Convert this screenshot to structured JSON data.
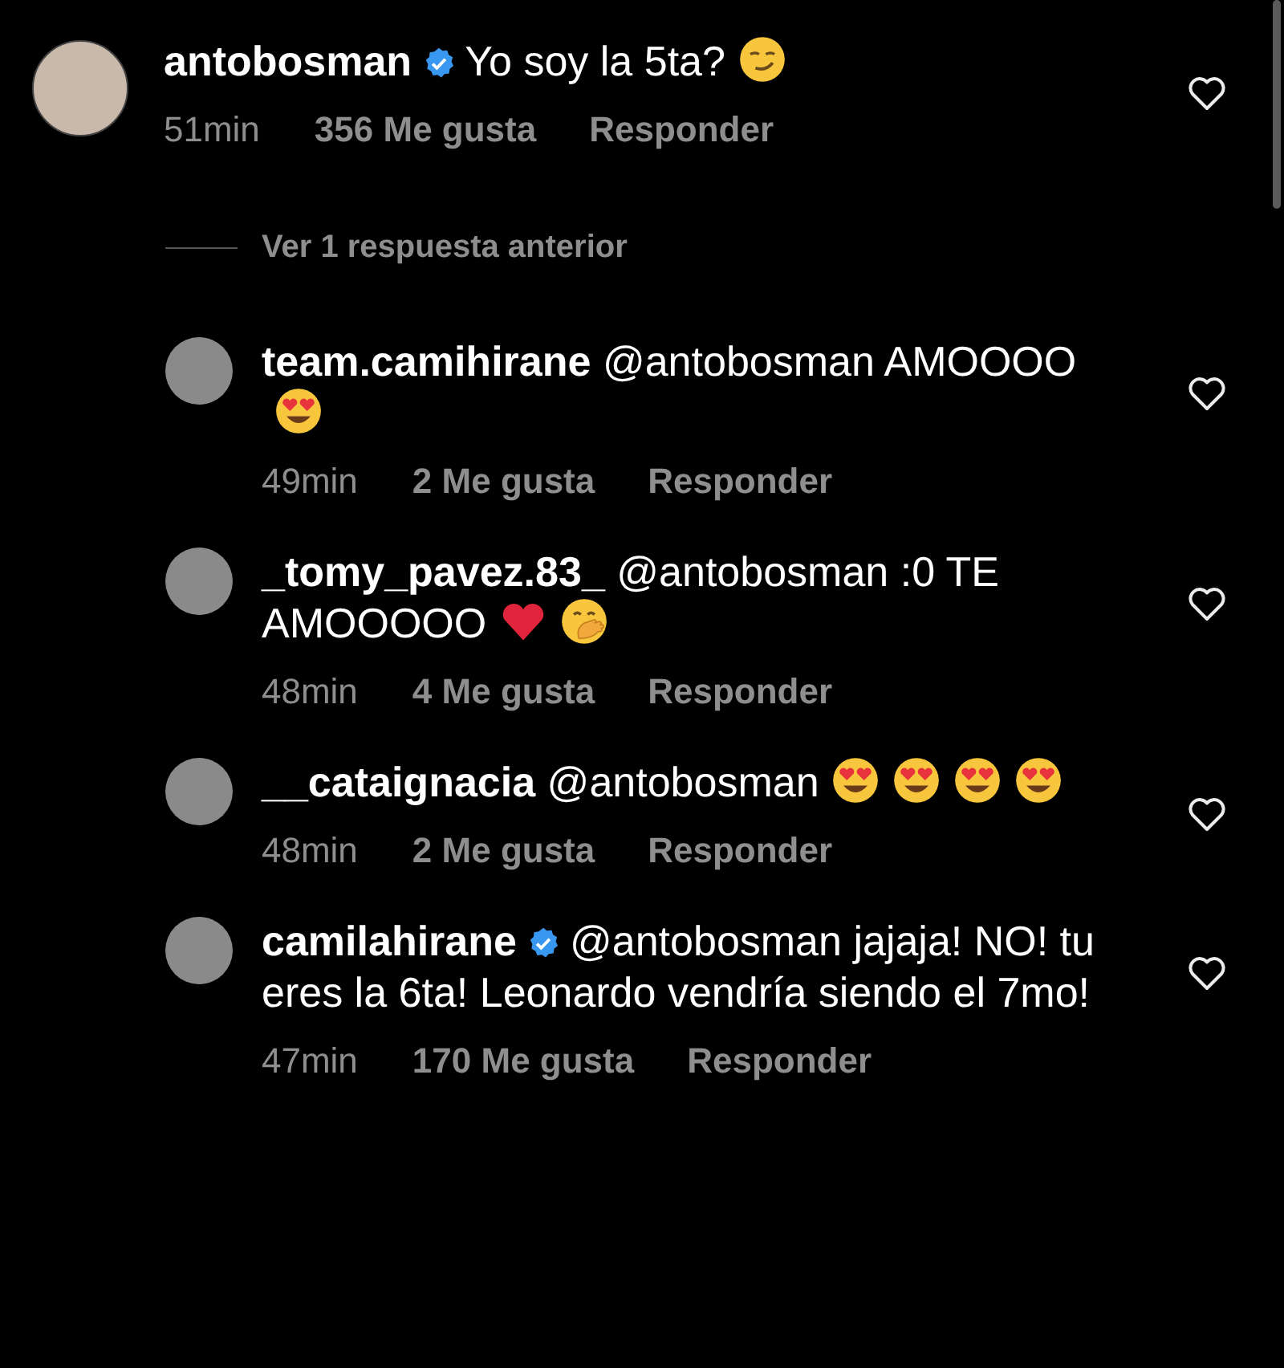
{
  "comment": {
    "username": "antobosman",
    "verified": true,
    "text": "Yo soy la 5ta?",
    "emojis": [
      {
        "kind": "smirk"
      }
    ],
    "time": "51min",
    "likes": "356 Me gusta",
    "reply_label": "Responder"
  },
  "view_replies": "Ver 1 respuesta anterior",
  "replies": [
    {
      "username": "team.camihirane",
      "verified": false,
      "text": "@antobosman AMOOOO",
      "emojis": [
        {
          "kind": "heart_eyes"
        }
      ],
      "time": "49min",
      "likes": "2 Me gusta",
      "reply_label": "Responder"
    },
    {
      "username": "_tomy_pavez.83_",
      "verified": false,
      "text": "@antobosman :0 TE AMOOOOO",
      "emojis": [
        {
          "kind": "red_heart"
        },
        {
          "kind": "hand_over_mouth"
        }
      ],
      "time": "48min",
      "likes": "4 Me gusta",
      "reply_label": "Responder"
    },
    {
      "username": "__cataignacia",
      "verified": false,
      "text": "@antobosman",
      "emojis": [
        {
          "kind": "heart_eyes"
        },
        {
          "kind": "heart_eyes"
        },
        {
          "kind": "heart_eyes"
        },
        {
          "kind": "heart_eyes"
        }
      ],
      "time": "48min",
      "likes": "2 Me gusta",
      "reply_label": "Responder"
    },
    {
      "username": "camilahirane",
      "verified": true,
      "text": "@antobosman jajaja! NO! tu eres la 6ta! Leonardo vendría siendo el 7mo!",
      "time": "47min",
      "likes": "170 Me gusta",
      "reply_label": "Responder"
    }
  ]
}
